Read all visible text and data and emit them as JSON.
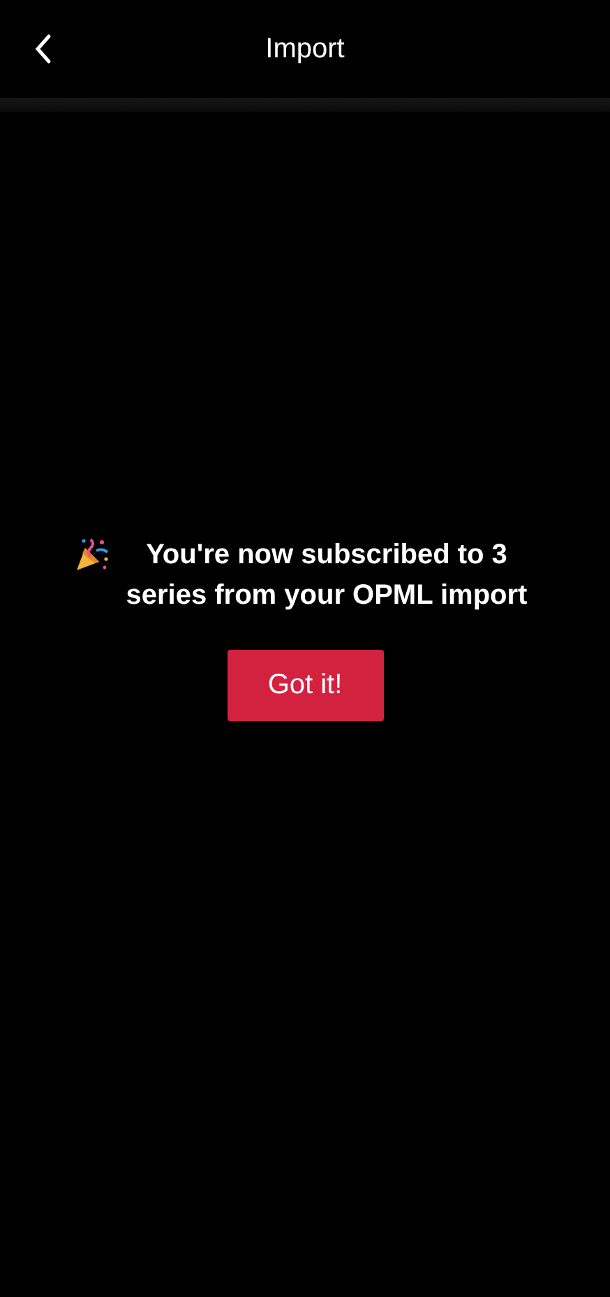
{
  "header": {
    "title": "Import"
  },
  "message": "You're now subscribed to 3 series from your OPML import",
  "button": "Got it!"
}
